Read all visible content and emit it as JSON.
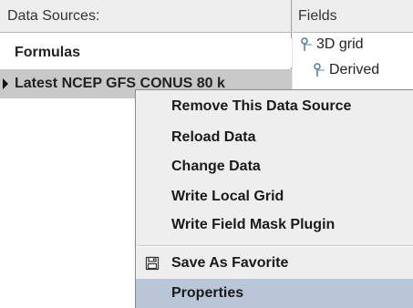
{
  "data_sources": {
    "header": "Data Sources:",
    "items": [
      {
        "label": "Formulas"
      },
      {
        "label": "Latest NCEP GFS CONUS 80 k"
      }
    ]
  },
  "fields": {
    "header": "Fields",
    "tree": [
      {
        "label": "3D grid"
      },
      {
        "label": "Derived"
      }
    ]
  },
  "context_menu": {
    "items": [
      {
        "label": "Remove This Data Source"
      },
      {
        "label": "Reload Data"
      },
      {
        "label": "Change Data"
      },
      {
        "label": "Write Local Grid"
      },
      {
        "label": "Write Field Mask Plugin"
      },
      {
        "label": "Save As Favorite",
        "icon": "floppy-disk-icon"
      },
      {
        "label": "Properties"
      }
    ],
    "highlight_color": "#b8c6d8"
  }
}
